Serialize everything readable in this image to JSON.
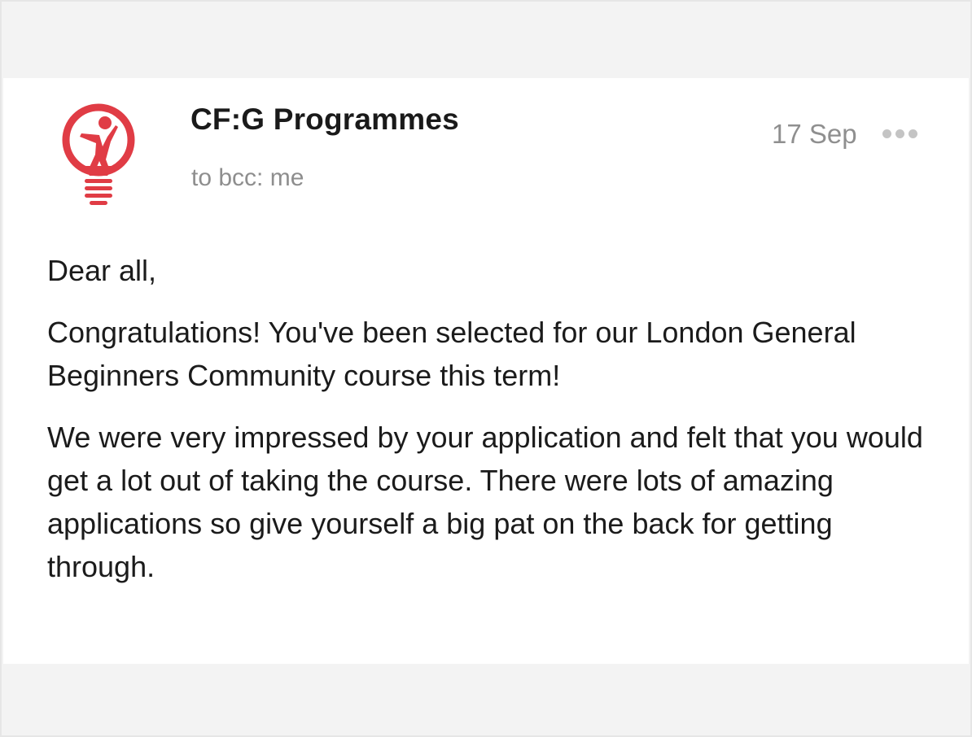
{
  "email": {
    "sender_name": "CF:G Programmes",
    "recipients": "to bcc: me",
    "date": "17 Sep",
    "more_icon": "more-horizontal-icon",
    "avatar_icon": "lightbulb-person-logo-icon",
    "brand_color": "#e03c45",
    "paragraphs": [
      "Dear all,",
      "Congratulations! You've been selected for our London General Beginners Community course this term!",
      "We were very impressed by your application and felt that you would get a lot out of taking the course. There were lots of amazing applications so give yourself a big pat on the back for getting through."
    ]
  }
}
